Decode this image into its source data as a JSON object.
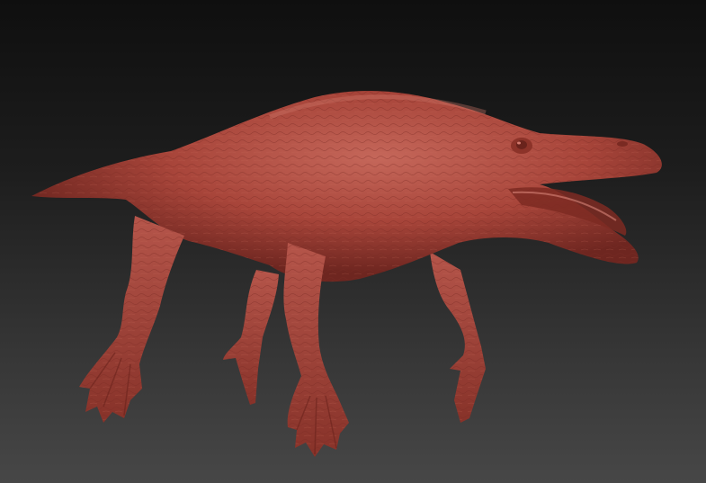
{
  "viewport": {
    "background_top": "#0f0f0f",
    "background_bottom": "#474747"
  },
  "model": {
    "subject": "sculpted-creature-icon",
    "material_color": "#a8453a",
    "highlight_color": "#c5675a",
    "shadow_color": "#6e2620"
  }
}
